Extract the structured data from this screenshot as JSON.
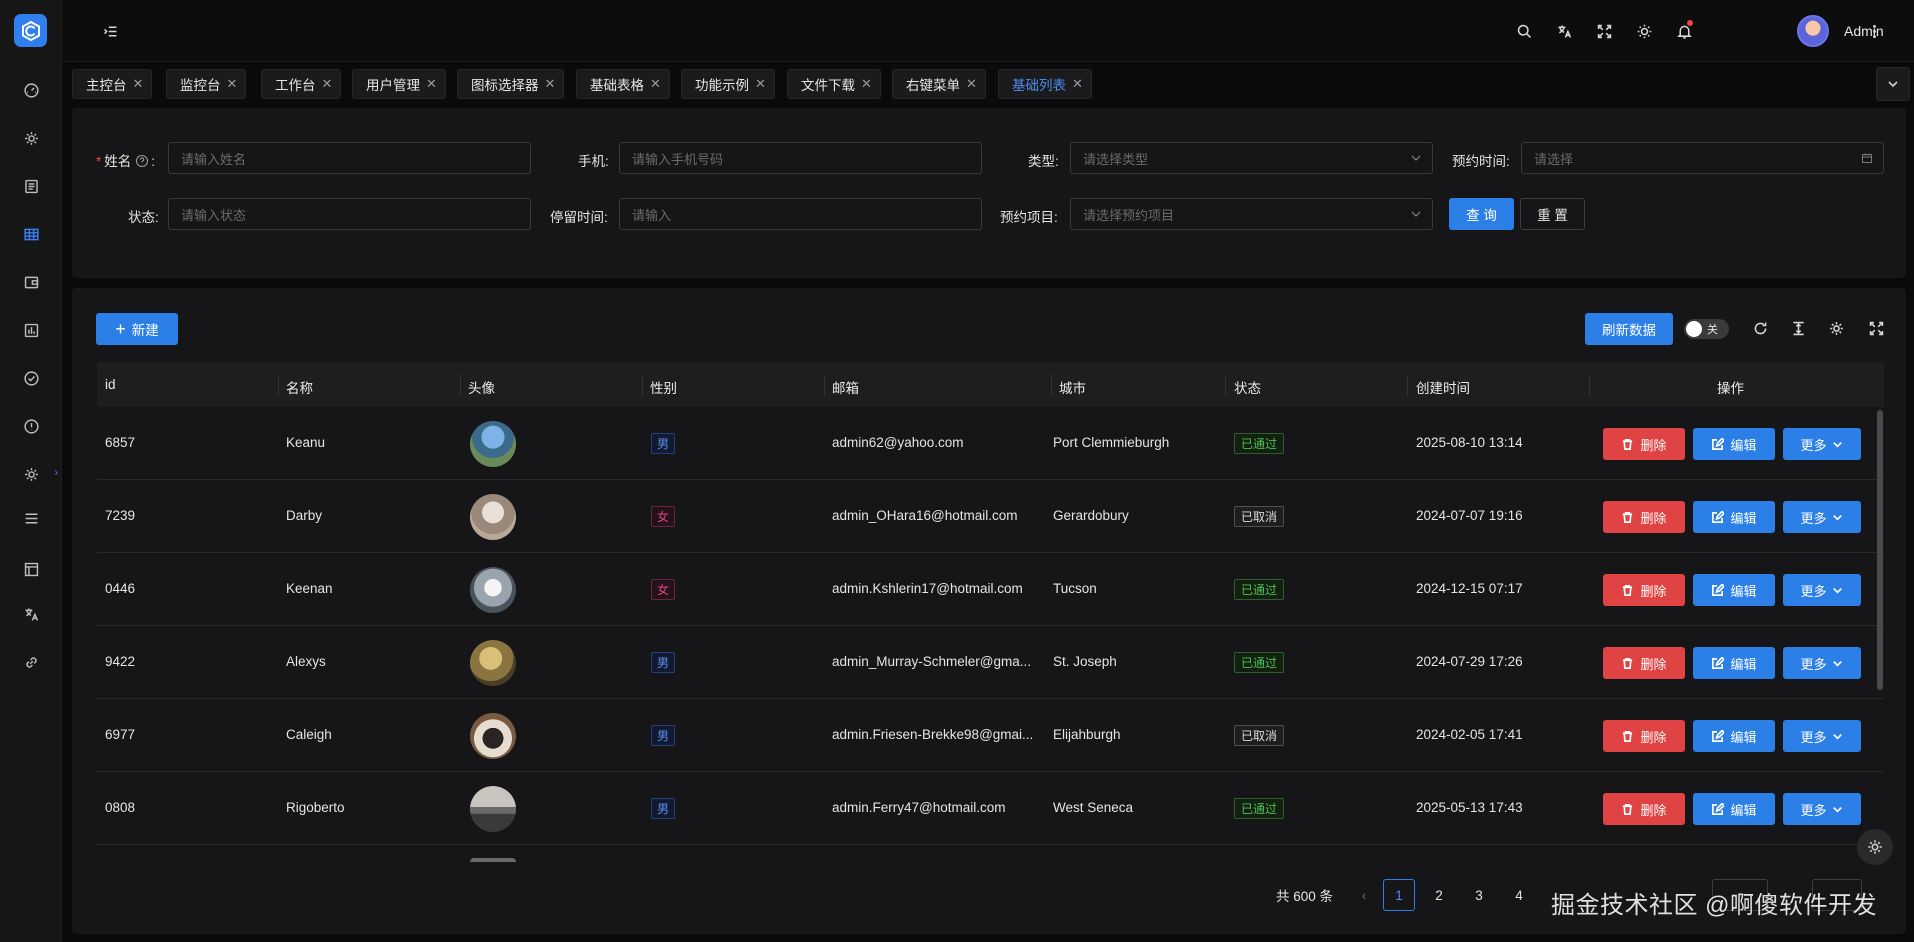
{
  "header": {
    "user_name": "Admin",
    "icons": [
      "menu-fold-icon",
      "search-icon",
      "translate-icon",
      "fullscreen-icon",
      "sun-icon",
      "bell-icon",
      "more-vertical-icon"
    ]
  },
  "sidebar": {
    "icons": [
      "dashboard-icon",
      "settings-icon",
      "document-icon",
      "table-icon",
      "wallet-icon",
      "chart-icon",
      "check-circle-icon",
      "alert-circle-icon",
      "system-icon",
      "menu-list-icon",
      "layout-icon",
      "translate-icon",
      "link-icon"
    ]
  },
  "tabs": [
    {
      "label": "主控台"
    },
    {
      "label": "监控台"
    },
    {
      "label": "工作台"
    },
    {
      "label": "用户管理"
    },
    {
      "label": "图标选择器"
    },
    {
      "label": "基础表格"
    },
    {
      "label": "功能示例"
    },
    {
      "label": "文件下载"
    },
    {
      "label": "右键菜单"
    },
    {
      "label": "基础列表"
    }
  ],
  "search_form": {
    "name_label": "姓名",
    "name_colon": ":",
    "name_placeholder": "请输入姓名",
    "phone_label": "手机:",
    "phone_placeholder": "请输入手机号码",
    "type_label": "类型:",
    "type_placeholder": "请选择类型",
    "appointment_time_label": "预约时间:",
    "appointment_time_placeholder": "请选择",
    "status_label": "状态:",
    "status_placeholder": "请输入状态",
    "stay_time_label": "停留时间:",
    "stay_time_placeholder": "请输入",
    "appointment_item_label": "预约项目:",
    "appointment_item_placeholder": "请选择预约项目",
    "query_label": "查 询",
    "reset_label": "重 置"
  },
  "toolbar": {
    "new_label": "新建",
    "refresh_label": "刷新数据",
    "switch_label": "关"
  },
  "table": {
    "columns": [
      "id",
      "名称",
      "头像",
      "性别",
      "邮箱",
      "城市",
      "状态",
      "创建时间",
      "操作"
    ],
    "rows": [
      {
        "id": "6857",
        "name": "Keanu",
        "gender": "男",
        "email": "admin62@yahoo.com",
        "city": "Port Clemmieburgh",
        "status": "已通过",
        "created": "2025-08-10 13:14"
      },
      {
        "id": "7239",
        "name": "Darby",
        "gender": "女",
        "email": "admin_OHara16@hotmail.com",
        "city": "Gerardobury",
        "status": "已取消",
        "created": "2024-07-07 19:16"
      },
      {
        "id": "0446",
        "name": "Keenan",
        "gender": "女",
        "email": "admin.Kshlerin17@hotmail.com",
        "city": "Tucson",
        "status": "已通过",
        "created": "2024-12-15 07:17"
      },
      {
        "id": "9422",
        "name": "Alexys",
        "gender": "男",
        "email": "admin_Murray-Schmeler@gma...",
        "city": "St. Joseph",
        "status": "已通过",
        "created": "2024-07-29 17:26"
      },
      {
        "id": "6977",
        "name": "Caleigh",
        "gender": "男",
        "email": "admin.Friesen-Brekke98@gmai...",
        "city": "Elijahburgh",
        "status": "已取消",
        "created": "2024-02-05 17:41"
      },
      {
        "id": "0808",
        "name": "Rigoberto",
        "gender": "男",
        "email": "admin.Ferry47@hotmail.com",
        "city": "West Seneca",
        "status": "已通过",
        "created": "2025-05-13 17:43"
      }
    ],
    "actions": {
      "delete": "删除",
      "edit": "编辑",
      "more": "更多"
    }
  },
  "pagination": {
    "total": "共 600 条",
    "pages": [
      "1",
      "2",
      "3",
      "4"
    ],
    "current": "1"
  },
  "watermark": "掘金技术社区 @啊傻软件开发"
}
